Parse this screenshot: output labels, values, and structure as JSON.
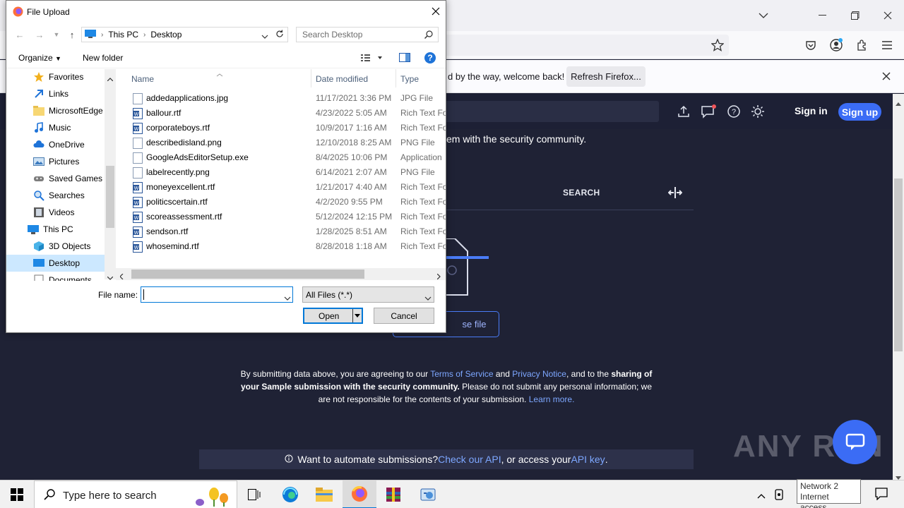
{
  "browser": {
    "notification": {
      "text": "d by the way, welcome back!",
      "refresh_label": "Refresh Firefox..."
    }
  },
  "site": {
    "sign_in": "Sign in",
    "sign_up": "Sign up",
    "share_text": "em with the security community.",
    "search_tab": "SEARCH",
    "choose_file": "se file",
    "terms": {
      "p1": "By submitting data above, you are agreeing to our ",
      "tos": "Terms of Service",
      "p2": " and ",
      "privacy": "Privacy Notice",
      "p3": ", and to the ",
      "bold1": "sharing of your Sample submission with the security community.",
      "p4": " Please do not submit any personal information; we are not responsible for the contents of your submission. ",
      "learn_more": "Learn more."
    },
    "api_bar": {
      "p1": "Want to automate submissions? ",
      "api_link": "Check our API",
      "p2": ", or access your ",
      "key_link": "API key",
      "p3": "."
    },
    "watermark": "ANY RUN"
  },
  "dialog": {
    "title": "File Upload",
    "breadcrumb": [
      "This PC",
      "Desktop"
    ],
    "search_placeholder": "Search Desktop",
    "organize": "Organize",
    "new_folder": "New folder",
    "nav_items": [
      {
        "label": "Favorites",
        "icon": "star-icon"
      },
      {
        "label": "Links",
        "icon": "link-icon"
      },
      {
        "label": "MicrosoftEdge",
        "icon": "folder-icon"
      },
      {
        "label": "Music",
        "icon": "music-icon"
      },
      {
        "label": "OneDrive",
        "icon": "cloud-icon"
      },
      {
        "label": "Pictures",
        "icon": "pictures-icon"
      },
      {
        "label": "Saved Games",
        "icon": "games-icon"
      },
      {
        "label": "Searches",
        "icon": "search-icon"
      },
      {
        "label": "Videos",
        "icon": "videos-icon"
      },
      {
        "label": "This PC",
        "icon": "computer-icon"
      },
      {
        "label": "3D Objects",
        "icon": "cube-icon"
      },
      {
        "label": "Desktop",
        "icon": "desktop-icon"
      },
      {
        "label": "Documents",
        "icon": "documents-icon"
      }
    ],
    "columns": [
      "Name",
      "Date modified",
      "Type"
    ],
    "files": [
      {
        "name": "addedapplications.jpg",
        "date": "11/17/2021 3:36 PM",
        "type": "JPG File"
      },
      {
        "name": "ballour.rtf",
        "date": "4/23/2022 5:05 AM",
        "type": "Rich Text For"
      },
      {
        "name": "corporateboys.rtf",
        "date": "10/9/2017 1:16 AM",
        "type": "Rich Text For"
      },
      {
        "name": "describedisland.png",
        "date": "12/10/2018 8:25 AM",
        "type": "PNG File"
      },
      {
        "name": "GoogleAdsEditorSetup.exe",
        "date": "8/4/2025 10:06 PM",
        "type": "Application"
      },
      {
        "name": "labelrecently.png",
        "date": "6/14/2021 2:07 AM",
        "type": "PNG File"
      },
      {
        "name": "moneyexcellent.rtf",
        "date": "1/21/2017 4:40 AM",
        "type": "Rich Text For"
      },
      {
        "name": "politicscertain.rtf",
        "date": "4/2/2020 9:55 PM",
        "type": "Rich Text For"
      },
      {
        "name": "scoreassessment.rtf",
        "date": "5/12/2024 12:15 PM",
        "type": "Rich Text For"
      },
      {
        "name": "sendson.rtf",
        "date": "1/28/2025 8:51 AM",
        "type": "Rich Text For"
      },
      {
        "name": "whosemind.rtf",
        "date": "8/28/2018 1:18 AM",
        "type": "Rich Text For"
      }
    ],
    "file_name_label": "File name:",
    "file_name_value": "",
    "filter": "All Files (*.*)",
    "open": "Open",
    "cancel": "Cancel"
  },
  "taskbar": {
    "search_placeholder": "Type here to search",
    "network_tip": [
      "Network 2",
      "Internet access"
    ]
  }
}
